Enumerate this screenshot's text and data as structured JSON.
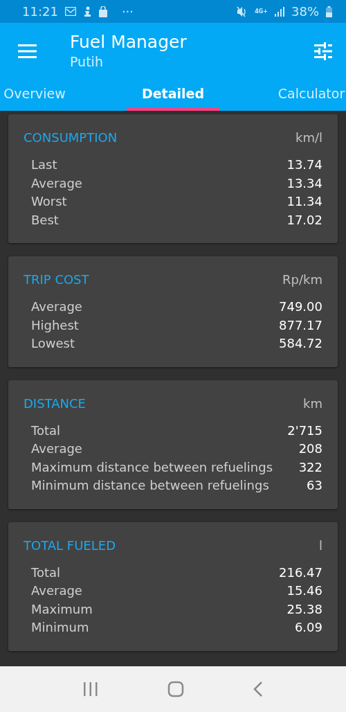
{
  "status_bar": {
    "time": "11:21",
    "more": "···",
    "network_type": "4G+",
    "battery": "38%"
  },
  "app_bar": {
    "title": "Fuel Manager",
    "subtitle": "Putih"
  },
  "tabs": [
    {
      "label": "Overview",
      "selected": false
    },
    {
      "label": "Detailed",
      "selected": true
    },
    {
      "label": "Calculator",
      "selected": false
    }
  ],
  "cards": [
    {
      "title": "CONSUMPTION",
      "unit": "km/l",
      "rows": [
        {
          "label": "Last",
          "value": "13.74"
        },
        {
          "label": "Average",
          "value": "13.34"
        },
        {
          "label": "Worst",
          "value": "11.34"
        },
        {
          "label": "Best",
          "value": "17.02"
        }
      ]
    },
    {
      "title": "TRIP COST",
      "unit": "Rp/km",
      "rows": [
        {
          "label": "Average",
          "value": "749.00"
        },
        {
          "label": "Highest",
          "value": "877.17"
        },
        {
          "label": "Lowest",
          "value": "584.72"
        }
      ]
    },
    {
      "title": "DISTANCE",
      "unit": "km",
      "rows": [
        {
          "label": "Total",
          "value": "2'715"
        },
        {
          "label": "Average",
          "value": "208"
        },
        {
          "label": "Maximum distance between refuelings",
          "value": "322"
        },
        {
          "label": "Minimum distance between refuelings",
          "value": "63"
        }
      ]
    },
    {
      "title": "TOTAL FUELED",
      "unit": "l",
      "rows": [
        {
          "label": "Total",
          "value": "216.47"
        },
        {
          "label": "Average",
          "value": "15.46"
        },
        {
          "label": "Maximum",
          "value": "25.38"
        },
        {
          "label": "Minimum",
          "value": "6.09"
        }
      ]
    }
  ]
}
